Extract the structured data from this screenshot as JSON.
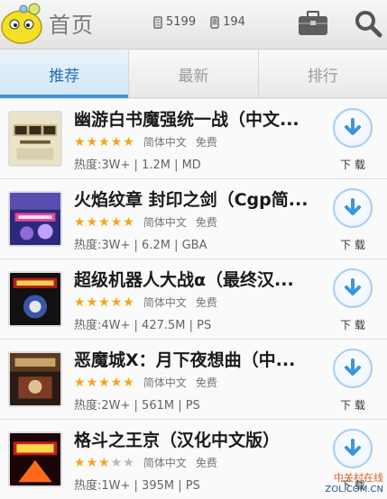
{
  "header": {
    "title": "首页",
    "games_count": "5199",
    "apps_count": "194"
  },
  "tabs": [
    {
      "label": "推荐",
      "active": true
    },
    {
      "label": "最新",
      "active": false
    },
    {
      "label": "排行",
      "active": false
    }
  ],
  "games": [
    {
      "title": "幽游白书魔强统一战（中文...",
      "rating": 5,
      "language": "简体中文",
      "price": "免费",
      "info": "热度:3W+ | 1.2M | MD",
      "download_label": "下 载"
    },
    {
      "title": "火焰纹章 封印之剑（Cgp简...",
      "rating": 5,
      "language": "简体中文",
      "price": "免费",
      "info": "热度:3W+ | 6.2M | GBA",
      "download_label": "下 载"
    },
    {
      "title": "超级机器人大战α（最终汉...",
      "rating": 5,
      "language": "简体中文",
      "price": "免费",
      "info": "热度:4W+ | 427.5M | PS",
      "download_label": "下 载"
    },
    {
      "title": "恶魔城X：月下夜想曲（中...",
      "rating": 5,
      "language": "简体中文",
      "price": "免费",
      "info": "热度:2W+ | 561M | PS",
      "download_label": "下 载"
    },
    {
      "title": "格斗之王京（汉化中文版）",
      "rating": 3,
      "language": "简体中文",
      "price": "免费",
      "info": "热度:1W+ | 395M | PS",
      "download_label": "下 载"
    }
  ],
  "watermark": {
    "line1": "中关村在线",
    "line2": "ZOL.COM.CN"
  },
  "colors": {
    "accent": "#3e94d8",
    "star": "#f2a619"
  }
}
